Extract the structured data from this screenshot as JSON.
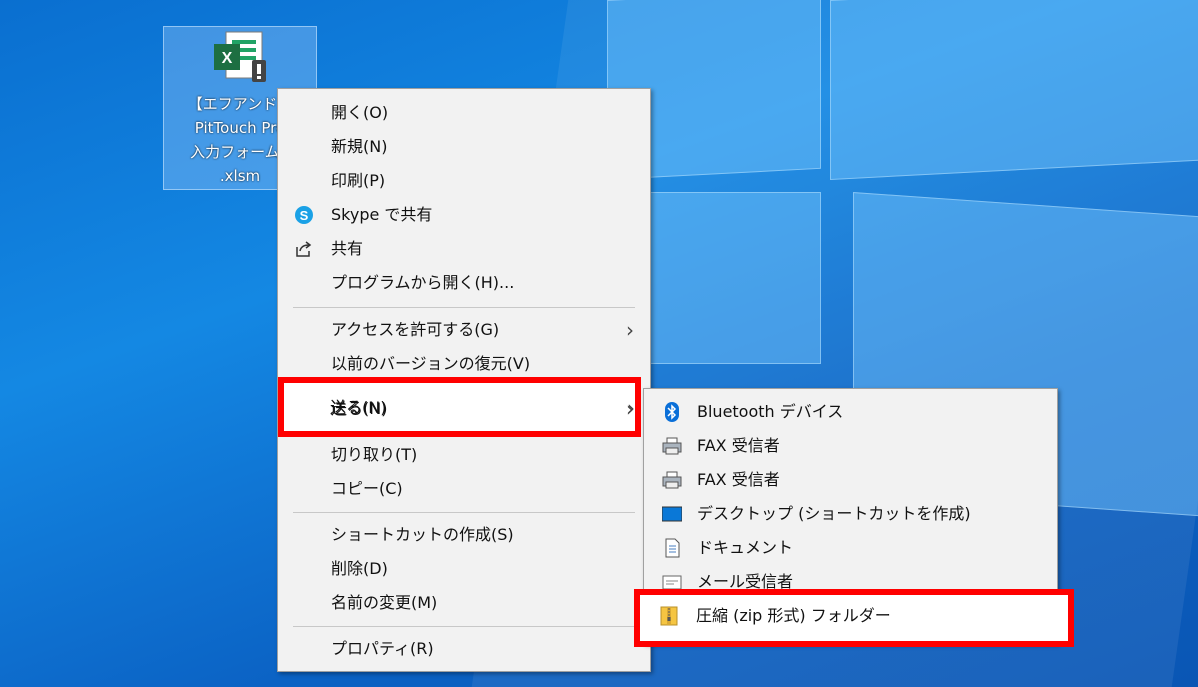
{
  "desktop": {
    "file_label_lines": [
      "【エフアンドエ",
      "PitTouch Pro",
      "入力フォームV",
      ".xlsm"
    ]
  },
  "context_menu": {
    "items": [
      {
        "label": "開く(O)"
      },
      {
        "label": "新規(N)"
      },
      {
        "label": "印刷(P)"
      },
      {
        "label": "Skype で共有",
        "icon": "skype-icon"
      },
      {
        "label": "共有",
        "icon": "share-icon"
      },
      {
        "label": "プログラムから開く(H)..."
      },
      {
        "label": "アクセスを許可する(G)",
        "submenu": true
      },
      {
        "label": "以前のバージョンの復元(V)"
      },
      {
        "label": "送る(N)",
        "submenu": true,
        "highlighted": true
      },
      {
        "label": "切り取り(T)"
      },
      {
        "label": "コピー(C)"
      },
      {
        "label": "ショートカットの作成(S)"
      },
      {
        "label": "削除(D)"
      },
      {
        "label": "名前の変更(M)"
      },
      {
        "label": "プロパティ(R)"
      }
    ]
  },
  "send_to_menu": {
    "items": [
      {
        "label": "Bluetooth デバイス",
        "icon": "bluetooth-icon"
      },
      {
        "label": "FAX 受信者",
        "icon": "fax-icon"
      },
      {
        "label": "FAX 受信者",
        "icon": "fax-icon"
      },
      {
        "label": "デスクトップ (ショートカットを作成)",
        "icon": "desktop-icon"
      },
      {
        "label": "ドキュメント",
        "icon": "document-icon"
      },
      {
        "label": "メール受信者",
        "icon": "mail-icon"
      },
      {
        "label": "圧縮 (zip 形式) フォルダー",
        "icon": "zip-folder-icon",
        "highlighted": true
      }
    ]
  },
  "colors": {
    "highlight_box": "#ff0000",
    "menu_bg": "#f2f2f2",
    "excel_green": "#1d6f42"
  }
}
